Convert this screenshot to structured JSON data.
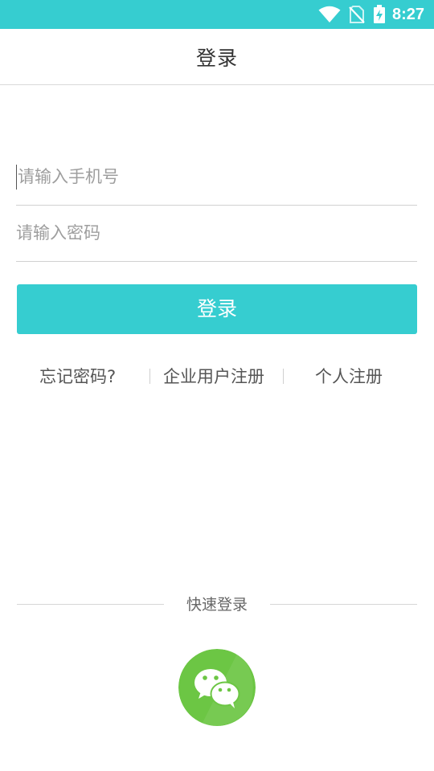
{
  "status_bar": {
    "time": "8:27",
    "icons": [
      "wifi-icon",
      "no-sim-icon",
      "battery-charging-icon"
    ],
    "color": "#36cdd0"
  },
  "header": {
    "title": "登录"
  },
  "form": {
    "phone_placeholder": "请输入手机号",
    "password_placeholder": "请输入密码",
    "login_label": "登录"
  },
  "links": {
    "forgot_password": "忘记密码?",
    "enterprise_register": "企业用户注册",
    "personal_register": "个人注册"
  },
  "quick_login": {
    "label": "快速登录",
    "icon": "wechat-icon",
    "icon_color": "#6cc644"
  },
  "colors": {
    "accent": "#36cdd0",
    "wechat_green": "#6cc644"
  }
}
